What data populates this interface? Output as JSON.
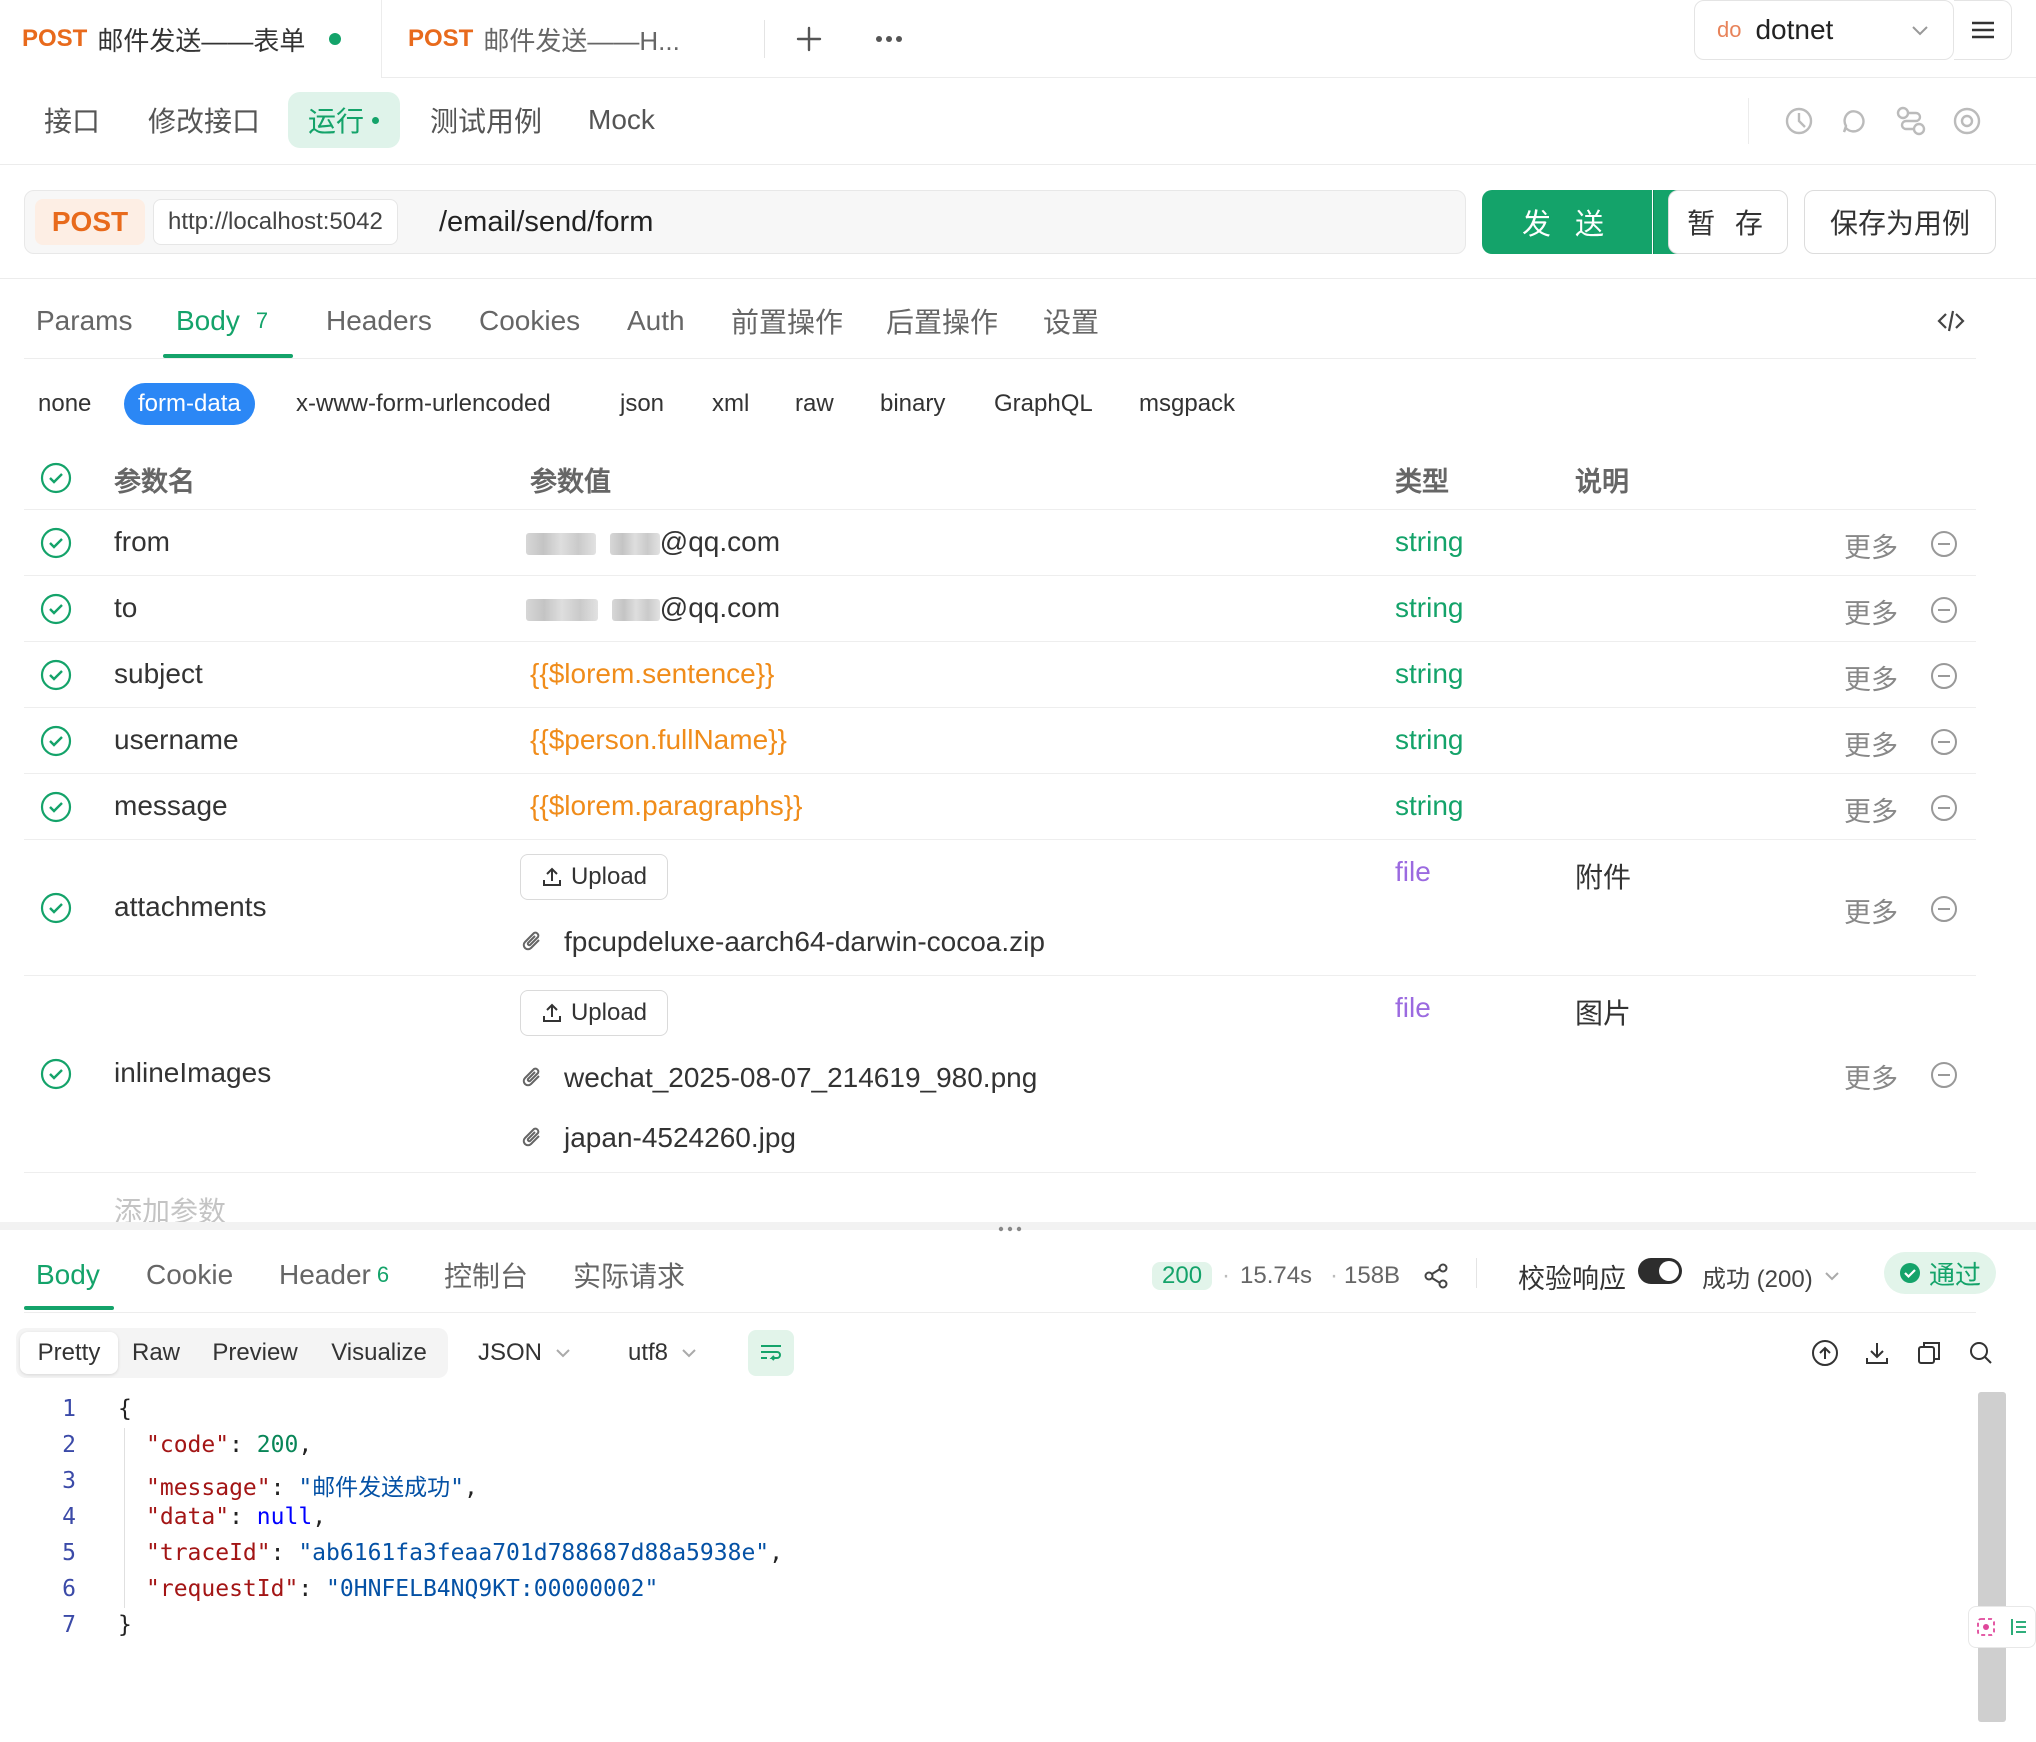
{
  "tabs": [
    {
      "method": "POST",
      "title": "邮件发送——表单",
      "modified": true
    },
    {
      "method": "POST",
      "title": "邮件发送——H..."
    }
  ],
  "environment": {
    "badge": "do",
    "name": "dotnet"
  },
  "sub_tabs": [
    "接口",
    "修改接口",
    "运行",
    "测试用例",
    "Mock"
  ],
  "request": {
    "method": "POST",
    "base_url": "http://localhost:5042",
    "path": "/email/send/form",
    "send_label": "发 送",
    "save_label": "暂 存",
    "save_as_case_label": "保存为用例"
  },
  "param_tabs": [
    "Params",
    "Body",
    "Headers",
    "Cookies",
    "Auth",
    "前置操作",
    "后置操作",
    "设置"
  ],
  "body_count": "7",
  "body_types": [
    "none",
    "form-data",
    "x-www-form-urlencoded",
    "json",
    "xml",
    "raw",
    "binary",
    "GraphQL",
    "msgpack"
  ],
  "table": {
    "headers": {
      "name": "参数名",
      "value": "参数值",
      "type": "类型",
      "desc": "说明"
    },
    "more_label": "更多",
    "upload_label": "Upload",
    "rows": [
      {
        "name": "from",
        "value": "@qq.com",
        "type": "string"
      },
      {
        "name": "to",
        "value": "@qq.com",
        "type": "string"
      },
      {
        "name": "subject",
        "value": "{{$lorem.sentence}}",
        "type": "string"
      },
      {
        "name": "username",
        "value": "{{$person.fullName}}",
        "type": "string"
      },
      {
        "name": "message",
        "value": "{{$lorem.paragraphs}}",
        "type": "string"
      },
      {
        "name": "attachments",
        "type": "file",
        "desc": "附件",
        "files": [
          "fpcupdeluxe-aarch64-darwin-cocoa.zip"
        ]
      },
      {
        "name": "inlineImages",
        "type": "file",
        "desc": "图片",
        "files": [
          "wechat_2025-08-07_214619_980.png",
          "japan-4524260.jpg"
        ]
      }
    ],
    "add_placeholder": "添加参数"
  },
  "response": {
    "tabs": [
      "Body",
      "Cookie",
      "Header",
      "控制台",
      "实际请求"
    ],
    "header_count": "6",
    "status": "200",
    "time": "15.74s",
    "size": "158B",
    "validate_label": "校验响应",
    "validate_on": true,
    "result_select": "成功 (200)",
    "pass_label": "通过",
    "formats": [
      "Pretty",
      "Raw",
      "Preview",
      "Visualize"
    ],
    "content_type": "JSON",
    "encoding": "utf8",
    "json_lines": {
      "code_key": "\"code\"",
      "code_val": "200",
      "message_key": "\"message\"",
      "message_val": "\"邮件发送成功\"",
      "data_key": "\"data\"",
      "data_val": "null",
      "trace_key": "\"traceId\"",
      "trace_val": "\"ab6161fa3feaa701d788687d88a5938e\"",
      "request_key": "\"requestId\"",
      "request_val": "\"0HNFELB4NQ9KT:00000002\""
    },
    "line_numbers": [
      "1",
      "2",
      "3",
      "4",
      "5",
      "6",
      "7"
    ]
  },
  "colors": {
    "accent": "#14a36a",
    "method": "#e86a1c",
    "variable": "#f08c1a",
    "file_type": "#9b6ae0",
    "form_data": "#2b87f5"
  }
}
